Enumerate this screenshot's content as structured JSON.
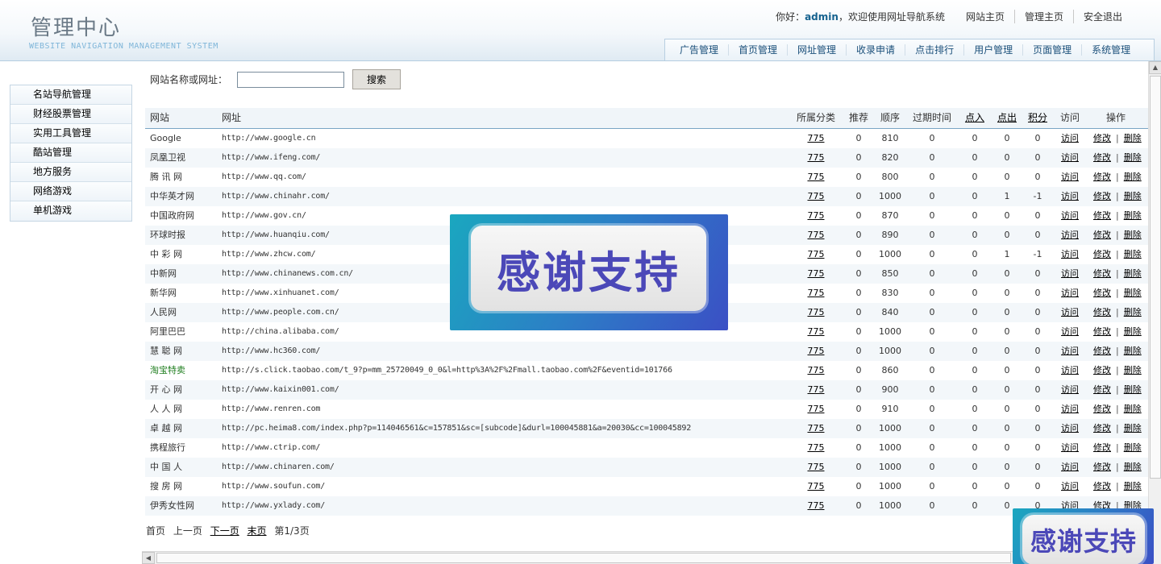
{
  "header": {
    "title": "管理中心",
    "subtitle": "WEBSITE NAVIGATION MANAGEMENT SYSTEM",
    "greeting_prefix": "你好：",
    "username": "admin",
    "greeting_suffix": "，欢迎使用网址导航系统",
    "links": [
      "网站主页",
      "管理主页",
      "安全退出"
    ],
    "tabs": [
      "广告管理",
      "首页管理",
      "网址管理",
      "收录申请",
      "点击排行",
      "用户管理",
      "页面管理",
      "系统管理"
    ]
  },
  "sidebar": {
    "items": [
      "名站导航管理",
      "财经股票管理",
      "实用工具管理",
      "酷站管理",
      "地方服务",
      "网络游戏",
      "单机游戏"
    ]
  },
  "search": {
    "label": "网站名称或网址：",
    "value": "",
    "button": "搜索"
  },
  "table": {
    "headers": {
      "name": "网站",
      "url": "网址",
      "category": "所属分类",
      "recommend": "推荐",
      "order": "顺序",
      "expire": "过期时间",
      "in": "点入",
      "out": "点出",
      "points": "积分",
      "visit": "访问",
      "ops": "操作"
    },
    "action_visit": "访问",
    "action_edit": "修改",
    "action_delete": "删除",
    "separator": "|",
    "rows": [
      {
        "name": "Google",
        "url": "http://www.google.cn",
        "category": "775",
        "recommend": "0",
        "order": "810",
        "expire": "0",
        "in": "0",
        "out": "0",
        "points": "0",
        "green": false
      },
      {
        "name": "凤凰卫视",
        "url": "http://www.ifeng.com/",
        "category": "775",
        "recommend": "0",
        "order": "820",
        "expire": "0",
        "in": "0",
        "out": "0",
        "points": "0",
        "green": false
      },
      {
        "name": "腾 讯 网",
        "url": "http://www.qq.com/",
        "category": "775",
        "recommend": "0",
        "order": "800",
        "expire": "0",
        "in": "0",
        "out": "0",
        "points": "0",
        "green": false
      },
      {
        "name": "中华英才网",
        "url": "http://www.chinahr.com/",
        "category": "775",
        "recommend": "0",
        "order": "1000",
        "expire": "0",
        "in": "0",
        "out": "1",
        "points": "-1",
        "green": false
      },
      {
        "name": "中国政府网",
        "url": "http://www.gov.cn/",
        "category": "775",
        "recommend": "0",
        "order": "870",
        "expire": "0",
        "in": "0",
        "out": "0",
        "points": "0",
        "green": false
      },
      {
        "name": "环球时报",
        "url": "http://www.huanqiu.com/",
        "category": "775",
        "recommend": "0",
        "order": "890",
        "expire": "0",
        "in": "0",
        "out": "0",
        "points": "0",
        "green": false
      },
      {
        "name": "中 彩 网",
        "url": "http://www.zhcw.com/",
        "category": "775",
        "recommend": "0",
        "order": "1000",
        "expire": "0",
        "in": "0",
        "out": "1",
        "points": "-1",
        "green": false
      },
      {
        "name": "中新网",
        "url": "http://www.chinanews.com.cn/",
        "category": "775",
        "recommend": "0",
        "order": "850",
        "expire": "0",
        "in": "0",
        "out": "0",
        "points": "0",
        "green": false
      },
      {
        "name": "新华网",
        "url": "http://www.xinhuanet.com/",
        "category": "775",
        "recommend": "0",
        "order": "830",
        "expire": "0",
        "in": "0",
        "out": "0",
        "points": "0",
        "green": false
      },
      {
        "name": "人民网",
        "url": "http://www.people.com.cn/",
        "category": "775",
        "recommend": "0",
        "order": "840",
        "expire": "0",
        "in": "0",
        "out": "0",
        "points": "0",
        "green": false
      },
      {
        "name": "阿里巴巴",
        "url": "http://china.alibaba.com/",
        "category": "775",
        "recommend": "0",
        "order": "1000",
        "expire": "0",
        "in": "0",
        "out": "0",
        "points": "0",
        "green": false
      },
      {
        "name": "慧 聪 网",
        "url": "http://www.hc360.com/",
        "category": "775",
        "recommend": "0",
        "order": "1000",
        "expire": "0",
        "in": "0",
        "out": "0",
        "points": "0",
        "green": false
      },
      {
        "name": "淘宝特卖",
        "url": "http://s.click.taobao.com/t_9?p=mm_25720049_0_0&l=http%3A%2F%2Fmall.taobao.com%2F&eventid=101766",
        "category": "775",
        "recommend": "0",
        "order": "860",
        "expire": "0",
        "in": "0",
        "out": "0",
        "points": "0",
        "green": true
      },
      {
        "name": "开 心 网",
        "url": "http://www.kaixin001.com/",
        "category": "775",
        "recommend": "0",
        "order": "900",
        "expire": "0",
        "in": "0",
        "out": "0",
        "points": "0",
        "green": false
      },
      {
        "name": "人 人 网",
        "url": "http://www.renren.com",
        "category": "775",
        "recommend": "0",
        "order": "910",
        "expire": "0",
        "in": "0",
        "out": "0",
        "points": "0",
        "green": false
      },
      {
        "name": "卓 越 网",
        "url": "http://pc.heima8.com/index.php?p=114046561&c=157851&sc=[subcode]&durl=100045881&a=20030&cc=100045892",
        "category": "775",
        "recommend": "0",
        "order": "1000",
        "expire": "0",
        "in": "0",
        "out": "0",
        "points": "0",
        "green": false
      },
      {
        "name": "携程旅行",
        "url": "http://www.ctrip.com/",
        "category": "775",
        "recommend": "0",
        "order": "1000",
        "expire": "0",
        "in": "0",
        "out": "0",
        "points": "0",
        "green": false
      },
      {
        "name": "中 国 人",
        "url": "http://www.chinaren.com/",
        "category": "775",
        "recommend": "0",
        "order": "1000",
        "expire": "0",
        "in": "0",
        "out": "0",
        "points": "0",
        "green": false
      },
      {
        "name": "搜 房 网",
        "url": "http://www.soufun.com/",
        "category": "775",
        "recommend": "0",
        "order": "1000",
        "expire": "0",
        "in": "0",
        "out": "0",
        "points": "0",
        "green": false
      },
      {
        "name": "伊秀女性网",
        "url": "http://www.yxlady.com/",
        "category": "775",
        "recommend": "0",
        "order": "1000",
        "expire": "0",
        "in": "0",
        "out": "0",
        "points": "0",
        "green": false
      }
    ]
  },
  "pager": {
    "first": "首页",
    "prev": "上一页",
    "next": "下一页",
    "last": "末页",
    "status": "第1/3页"
  },
  "overlay": {
    "main_text": "感谢支持",
    "corner_text": "感谢支持"
  },
  "colors": {
    "accent": "#15628f",
    "header_border": "#b5cde0",
    "row_alt": "#f3f7fa",
    "highlight_green": "#1e7d1e",
    "banner_text": "#4b48b8"
  }
}
